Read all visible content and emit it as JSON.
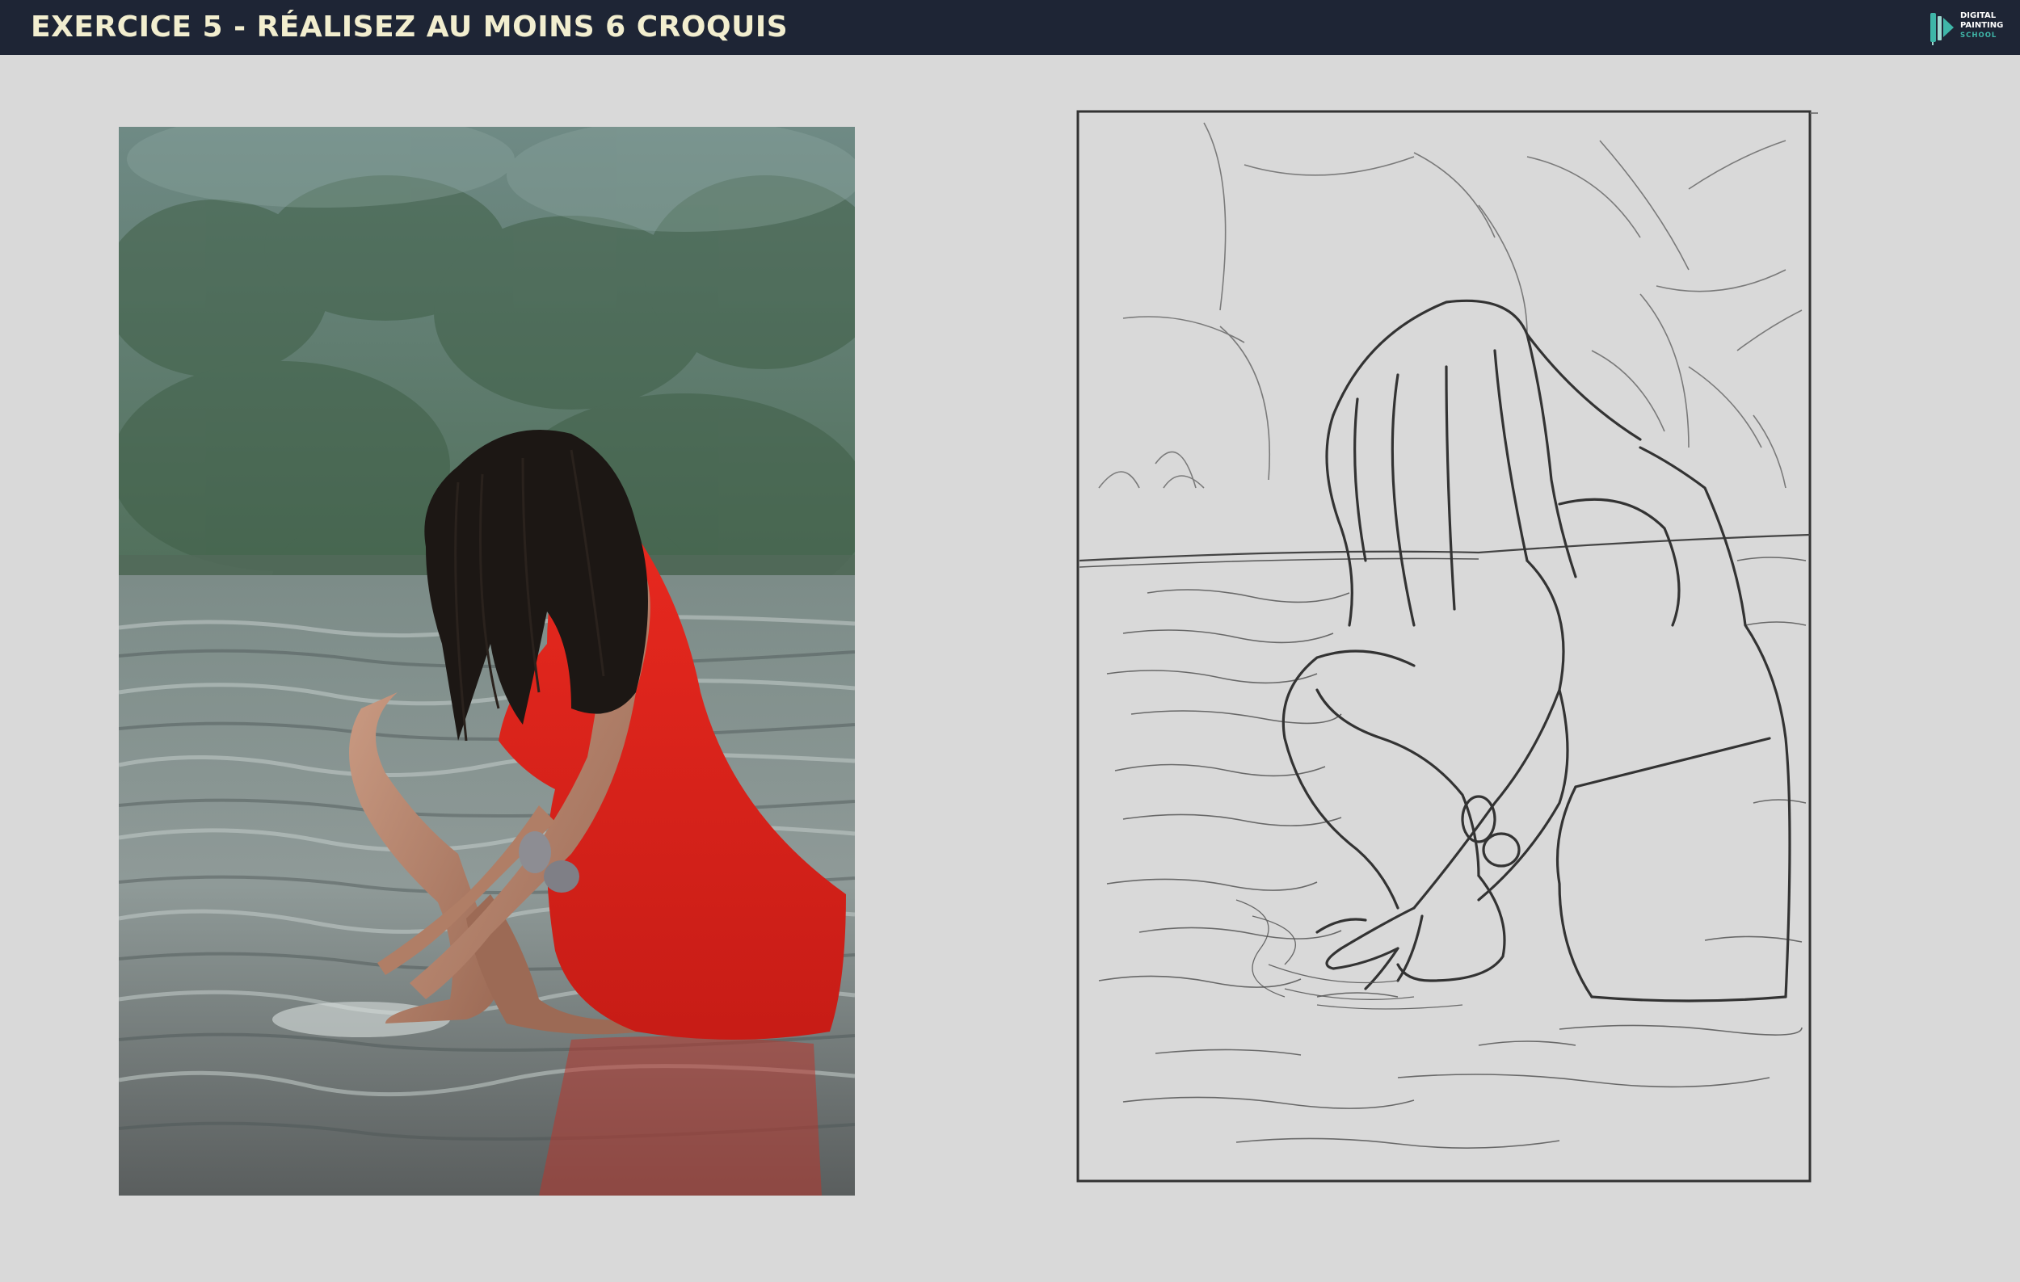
{
  "header": {
    "title": "EXERCICE 5 - RÉALISEZ AU MOINS 6 CROQUIS",
    "background": "#1e2535",
    "title_color": "#f2eecf"
  },
  "logo": {
    "line1": "DIGITAL",
    "line2": "PAINTING",
    "line3": "SCHOOL",
    "accent": "#3fb6a8"
  },
  "page": {
    "background": "#d9d9d9"
  },
  "reference_photo": {
    "subject": "woman in red dress crouching in lake water",
    "dress_color": "#e0261e"
  },
  "sketch": {
    "stroke_color": "#333333"
  }
}
